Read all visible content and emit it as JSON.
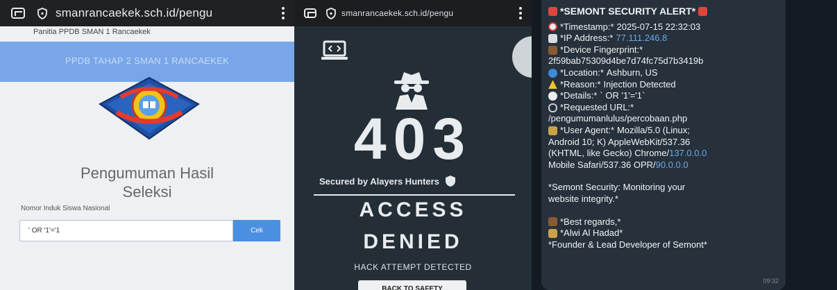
{
  "panel1": {
    "url": "smanrancaekek.sch.id/pengu",
    "site_name": "Panitia PPDB SMAN 1 Rancaekek",
    "banner_text": "PPDB TAHAP 2 SMAN 1 RANCAEKEK",
    "title_line1": "Pengumuman Hasil",
    "title_line2": "Seleksi",
    "input_label": "Nomor Induk Siswa Nasional",
    "input_value": "' OR '1'='1",
    "button_label": "Cek"
  },
  "panel2": {
    "url": "smanrancaekek.sch.id/pengu",
    "code": "403",
    "secured_by": "Secured by Alayers Hunters",
    "access": "ACCESS",
    "denied": "DENIED",
    "hack_msg": "HACK ATTEMPT DETECTED",
    "back_button": "BACK TO SAFETY"
  },
  "panel3": {
    "title": "*SEMONT SECURITY ALERT*",
    "timestamp_label": "*Timestamp:*",
    "timestamp": "2025-07-15 22:32:03",
    "ip_label": "*IP Address:*",
    "ip": "77.111.246.8",
    "fingerprint_label": "*Device Fingerprint:*",
    "fingerprint": "2f59bab75309d4be7d74fc75d7b3419b",
    "location_label": "*Location:*",
    "location": "Ashburn, US",
    "reason_label": "*Reason:*",
    "reason": "Injection Detected",
    "details_label": "*Details:*",
    "details": "` OR '1'='1`",
    "url_label": "*Requested URL:*",
    "requested_url": "/pengumumanlulus/percobaan.php",
    "ua_label": "*User Agent:*",
    "ua_part1": "Mozilla/5.0 (Linux;",
    "ua_line2": "Android 10; K) AppleWebKit/537.36",
    "ua_line3_pre": "(KHTML, like Gecko) Chrome/",
    "ua_chrome_ver": "137.0.0.0",
    "ua_line4_pre": "Mobile Safari/537.36 OPR/",
    "ua_opr_ver": "90.0.0.0",
    "monitor_line1": "*Semont Security: Monitoring your",
    "monitor_line2": "website integrity.*",
    "regards": "*Best regards,*",
    "name": "*Alwi Al Hadad*",
    "role": "*Founder & Lead Developer of Semont*",
    "time": "09:32"
  },
  "colors": {
    "banner": "#78a6e8",
    "button_blue": "#4a8fe0",
    "panel2_bg": "#242e36",
    "bubble_bg": "#26313c",
    "link": "#6aa9e6"
  }
}
